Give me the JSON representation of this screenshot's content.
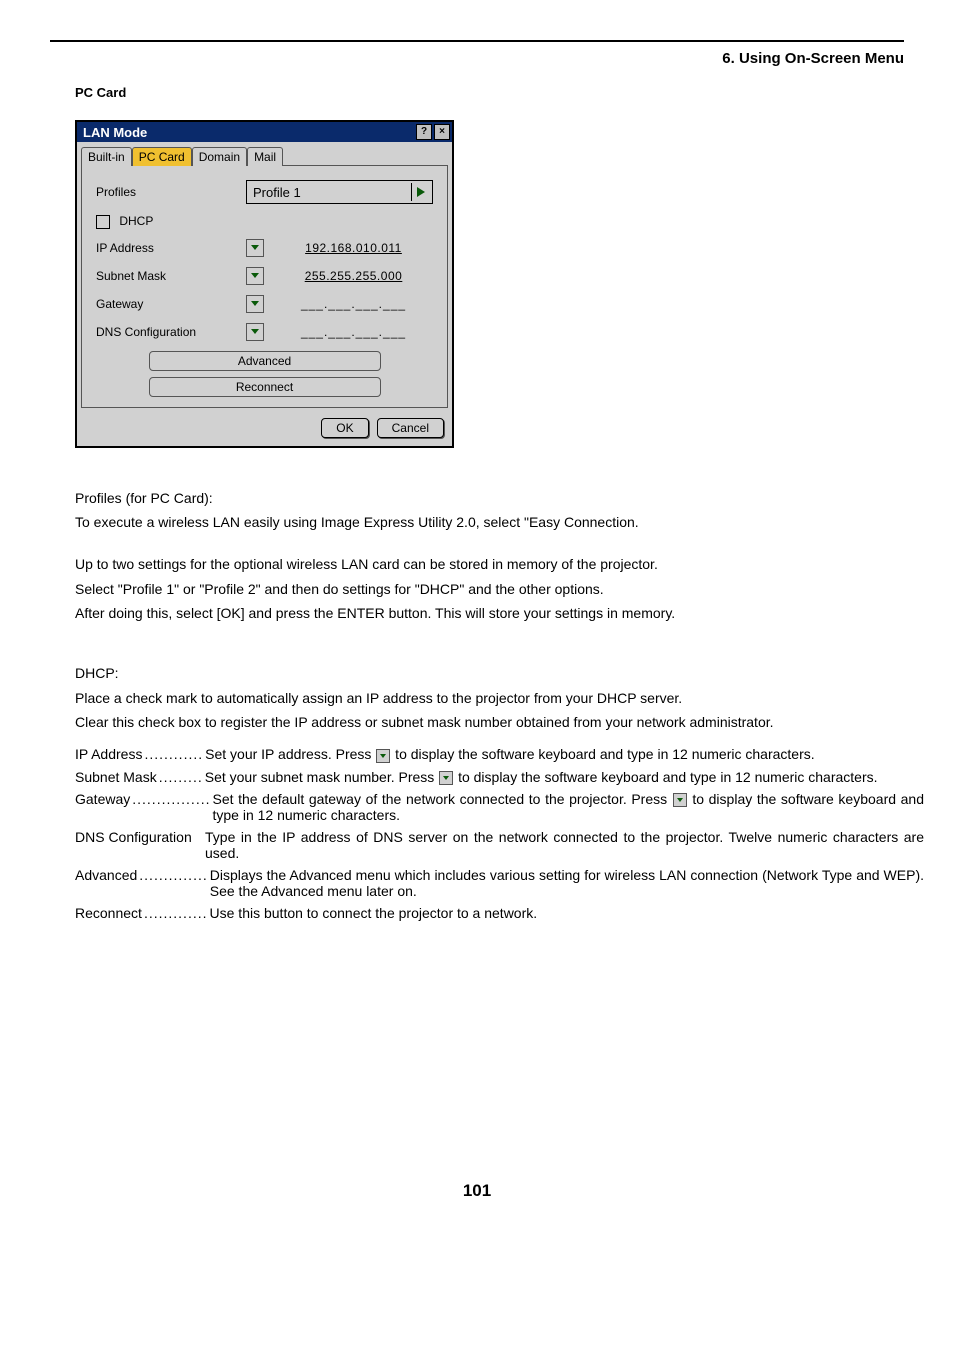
{
  "header": {
    "section": "6. Using On-Screen Menu",
    "subheading": "PC Card"
  },
  "dialog": {
    "title": "LAN Mode",
    "tabs": [
      "Built-in",
      "PC Card",
      "Domain",
      "Mail"
    ],
    "active_tab": 1,
    "fields": {
      "profiles_label": "Profiles",
      "profile_value": "Profile 1",
      "dhcp_label": "DHCP",
      "ip_label": "IP Address",
      "ip_value": "192.168.010.011",
      "subnet_label": "Subnet Mask",
      "subnet_value": "255.255.255.000",
      "gateway_label": "Gateway",
      "gateway_value": "___.___.___.___",
      "dns_label": "DNS Configuration",
      "dns_value": "___.___.___.___"
    },
    "buttons": {
      "advanced": "Advanced",
      "reconnect": "Reconnect",
      "ok": "OK",
      "cancel": "Cancel"
    }
  },
  "body": {
    "p1": "Profiles (for PC Card):",
    "p2": "To execute a wireless LAN easily using Image Express Utility 2.0, select \"Easy Connection.",
    "p3": "Up to two settings for the optional wireless LAN card can be stored in memory of the projector.",
    "p4": "Select \"Profile 1\" or \"Profile 2\" and then do settings for \"DHCP\" and the other options.",
    "p5": "After doing this, select [OK] and press the ENTER button. This will store your settings in memory.",
    "p6": "DHCP:",
    "p7": "Place a check mark to automatically assign an IP address to the projector from your DHCP server.",
    "p8": "Clear this check box to register the IP address or subnet mask number obtained from your network administrator."
  },
  "defs": {
    "ip_term": "IP Address",
    "ip_dots": "............",
    "ip_desc_a": "Set your IP address. Press ",
    "ip_desc_b": " to display the software keyboard and type in 12 numeric characters.",
    "subnet_term": "Subnet Mask",
    "subnet_dots": ".........",
    "subnet_desc_a": "Set your subnet mask number. Press ",
    "subnet_desc_b": " to display the software keyboard and type in 12 numeric characters.",
    "gateway_term": "Gateway",
    "gateway_dots": "................",
    "gateway_desc_a": "Set the default gateway of the network connected to the projector. Press ",
    "gateway_desc_b": " to display the software keyboard and type in 12 numeric characters.",
    "dns_term": "DNS Configuration",
    "dns_desc": "Type in the IP address of DNS server on the network connected to the projector. Twelve numeric characters are used.",
    "adv_term": "Advanced",
    "adv_dots": "..............",
    "adv_desc": "Displays the Advanced menu which includes various setting for wireless LAN connection (Network Type and WEP). See the Advanced menu later on.",
    "rec_term": "Reconnect",
    "rec_dots": ".............",
    "rec_desc": "Use this button to connect the projector to a network."
  },
  "page_number": "101"
}
